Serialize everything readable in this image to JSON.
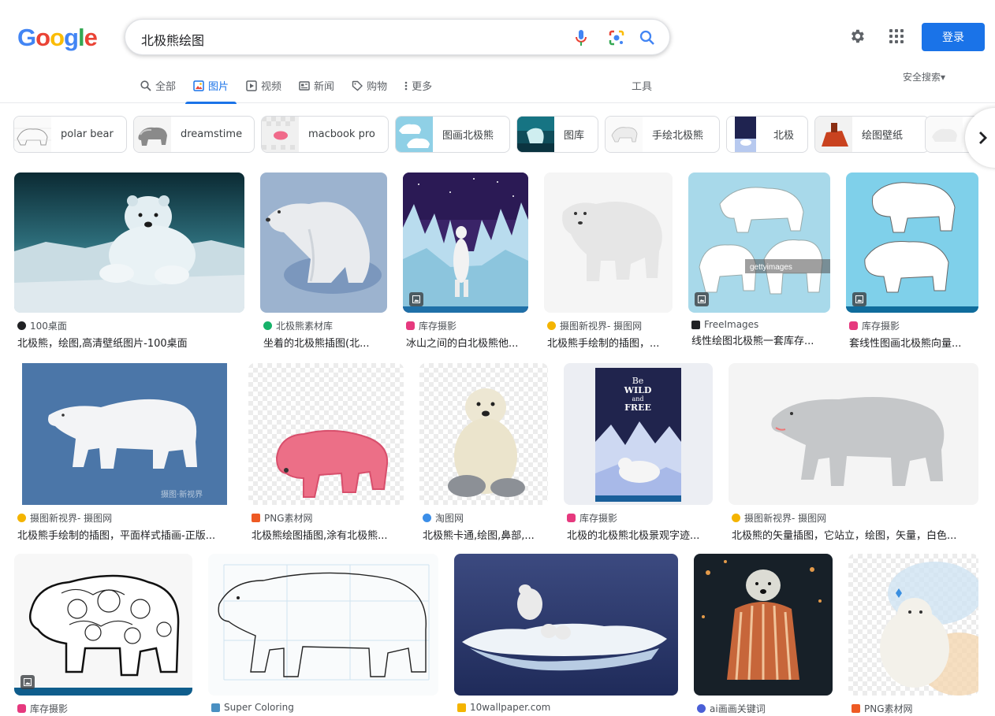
{
  "logo": [
    "G",
    "o",
    "o",
    "g",
    "l",
    "e"
  ],
  "logo_colors": [
    "#4285f4",
    "#ea4335",
    "#fbbc05",
    "#4285f4",
    "#34a853",
    "#ea4335"
  ],
  "search": {
    "query": "北极熊绘图"
  },
  "header": {
    "login_label": "登录",
    "settings_icon": "gear-icon",
    "apps_icon": "apps-grid-icon"
  },
  "tabs": [
    {
      "label": "全部",
      "icon": "search-icon"
    },
    {
      "label": "图片",
      "icon": "image-icon",
      "active": true
    },
    {
      "label": "视频",
      "icon": "play-icon"
    },
    {
      "label": "新闻",
      "icon": "news-icon"
    },
    {
      "label": "购物",
      "icon": "tag-icon"
    },
    {
      "label": "更多",
      "icon": "more-vert-icon"
    }
  ],
  "tools_label": "工具",
  "safesearch_label": "安全搜索▾",
  "chips": [
    {
      "label": "polar bear"
    },
    {
      "label": "dreamstime"
    },
    {
      "label": "macbook pro"
    },
    {
      "label": "图画北极熊"
    },
    {
      "label": "图库"
    },
    {
      "label": "手绘北极熊"
    },
    {
      "label": "北极"
    },
    {
      "label": "绘图壁纸"
    }
  ],
  "results": [
    {
      "source": "100桌面",
      "title": "北极熊，绘图,高清壁纸图片-100桌面"
    },
    {
      "source": "北极熊素材库",
      "title": "坐着的北极熊插图(北..."
    },
    {
      "source": "库存摄影",
      "title": "冰山之间的白北极熊他..."
    },
    {
      "source": "摄图新视界- 摄图网",
      "title": "北极熊手绘制的插图，..."
    },
    {
      "source": "FreeImages",
      "title": "线性绘图北极熊一套库存..."
    },
    {
      "source": "库存摄影",
      "title": "套线性图画北极熊向量..."
    },
    {
      "source": "摄图新视界- 摄图网",
      "title": "北极熊手绘制的插图，平面样式插画-正版..."
    },
    {
      "source": "PNG素材网",
      "title": "北极熊绘图插图,涂有北极熊..."
    },
    {
      "source": "淘图网",
      "title": "北极熊卡通,绘图,鼻部,..."
    },
    {
      "source": "库存摄影",
      "title": "北极的北极熊北极景观字迹..."
    },
    {
      "source": "摄图新视界- 摄图网",
      "title": "北极熊的矢量插图，它站立，绘图，矢量，白色..."
    },
    {
      "source": "库存摄影",
      "title": ""
    },
    {
      "source": "Super Coloring",
      "title": ""
    },
    {
      "source": "10wallpaper.com",
      "title": ""
    },
    {
      "source": "ai画画关键词",
      "title": ""
    },
    {
      "source": "PNG素材网",
      "title": ""
    }
  ],
  "image_text": {
    "wild_free": [
      "Be",
      "WILD",
      "and",
      "FREE"
    ],
    "gettyimages": "gettyimages",
    "watermark_sheying": "摄图·新视界"
  },
  "colors": {
    "accent": "#1a73e8",
    "text_secondary": "#5f6368",
    "source_text": "#4d5156"
  }
}
